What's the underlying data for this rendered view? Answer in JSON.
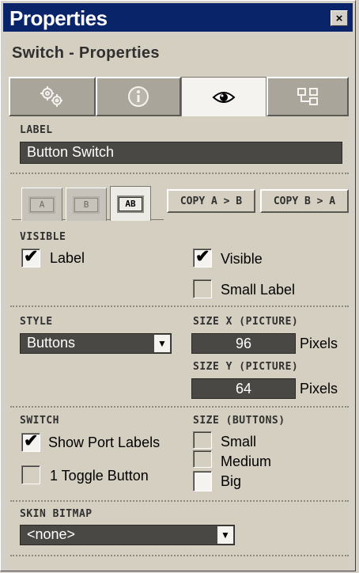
{
  "window": {
    "title": "Properties",
    "close_glyph": "×"
  },
  "heading": "Switch - Properties",
  "tabs": [
    {
      "name": "gears",
      "icon": "gears-icon",
      "active": false
    },
    {
      "name": "info",
      "icon": "info-icon",
      "active": false
    },
    {
      "name": "view",
      "icon": "eye-icon",
      "active": true
    },
    {
      "name": "structure",
      "icon": "structure-icon",
      "active": false
    }
  ],
  "label_section": {
    "title": "LABEL",
    "value": "Button Switch"
  },
  "ab_tabs": [
    {
      "label": "A",
      "active": false
    },
    {
      "label": "B",
      "active": false
    },
    {
      "label": "AB",
      "active": true
    }
  ],
  "copy_buttons": {
    "a_to_b": "COPY A > B",
    "b_to_a": "COPY B > A"
  },
  "visible_section": {
    "title": "VISIBLE",
    "label_check": {
      "text": "Label",
      "checked": true
    },
    "visible_check": {
      "text": "Visible",
      "checked": true
    },
    "small_label_check": {
      "text": "Small Label",
      "checked": false
    }
  },
  "style_section": {
    "title": "STYLE",
    "selected": "Buttons"
  },
  "size_x": {
    "title": "SIZE X (PICTURE)",
    "value": "96",
    "unit": "Pixels"
  },
  "size_y": {
    "title": "SIZE Y (PICTURE)",
    "value": "64",
    "unit": "Pixels"
  },
  "switch_section": {
    "title": "SWITCH",
    "show_port_labels": {
      "text": "Show Port Labels",
      "checked": true
    },
    "toggle_button": {
      "text": "1 Toggle Button",
      "checked": false
    }
  },
  "size_buttons": {
    "title": "SIZE (BUTTONS)",
    "options": [
      "Small",
      "Medium",
      "Big"
    ],
    "selected": "Big"
  },
  "skin_bitmap": {
    "title": "SKIN BITMAP",
    "selected": "<none>"
  },
  "colors": {
    "titlebar": "#0a246a",
    "panel": "#d4cfc0",
    "field": "#4a4844"
  }
}
